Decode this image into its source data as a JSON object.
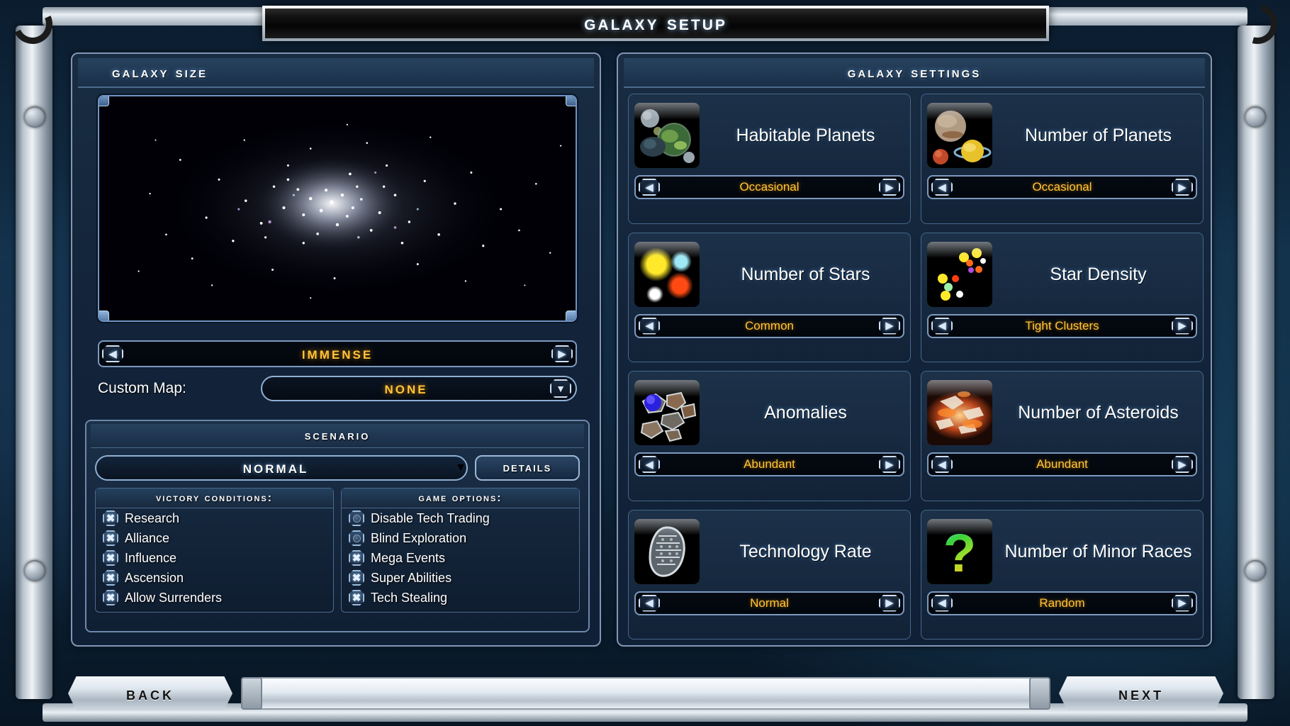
{
  "window": {
    "title": "Galaxy Setup"
  },
  "left_panel": {
    "title": "Galaxy Size",
    "size_selector": {
      "value": "Immense",
      "prev_icon": "chevron-left-icon",
      "next_icon": "chevron-right-icon"
    },
    "custom_map": {
      "label": "Custom Map:",
      "value": "None",
      "caret_icon": "chevron-down-icon"
    },
    "scenario": {
      "title": "Scenario",
      "selected": "Normal",
      "caret_icon": "chevron-down-icon",
      "details_label": "Details",
      "victory": {
        "title": "Victory Conditions:",
        "items": [
          {
            "label": "Research",
            "checked": true
          },
          {
            "label": "Alliance",
            "checked": true
          },
          {
            "label": "Influence",
            "checked": true
          },
          {
            "label": "Ascension",
            "checked": true
          },
          {
            "label": "Allow Surrenders",
            "checked": true
          }
        ]
      },
      "options": {
        "title": "Game Options:",
        "items": [
          {
            "label": "Disable Tech Trading",
            "checked": false
          },
          {
            "label": "Blind Exploration",
            "checked": false
          },
          {
            "label": "Mega Events",
            "checked": true
          },
          {
            "label": "Super Abilities",
            "checked": true
          },
          {
            "label": "Tech Stealing",
            "checked": true
          }
        ]
      }
    }
  },
  "right_panel": {
    "title": "Galaxy Settings",
    "cards": [
      {
        "label": "Habitable Planets",
        "value": "Occasional",
        "icon": "habitable-planets-icon",
        "border_color": "#e8c53a"
      },
      {
        "label": "Number of Planets",
        "value": "Occasional",
        "icon": "number-of-planets-icon",
        "border_color": "#e8c53a"
      },
      {
        "label": "Number of Stars",
        "value": "Common",
        "icon": "number-of-stars-icon",
        "border_color": "#2323e0"
      },
      {
        "label": "Star Density",
        "value": "Tight Clusters",
        "icon": "star-density-icon",
        "border_color": "#3ad23a"
      },
      {
        "label": "Anomalies",
        "value": "Abundant",
        "icon": "anomalies-icon",
        "border_color": "#3ad23a"
      },
      {
        "label": "Number of Asteroids",
        "value": "Abundant",
        "icon": "asteroids-icon",
        "border_color": "#d32c1f"
      },
      {
        "label": "Technology Rate",
        "value": "Normal",
        "icon": "technology-rate-icon",
        "border_color": "#e8c53a"
      },
      {
        "label": "Number of Minor Races",
        "value": "Random",
        "icon": "minor-races-question-icon",
        "border_color": "#3ad23a"
      }
    ],
    "prev_icon": "chevron-left-icon",
    "next_icon": "chevron-right-icon"
  },
  "footer": {
    "back_label": "Back",
    "next_label": "Next"
  },
  "colors": {
    "value_gold": "#ffc53d",
    "text_white": "#ffffff",
    "panel_border": "#7f97b5"
  }
}
